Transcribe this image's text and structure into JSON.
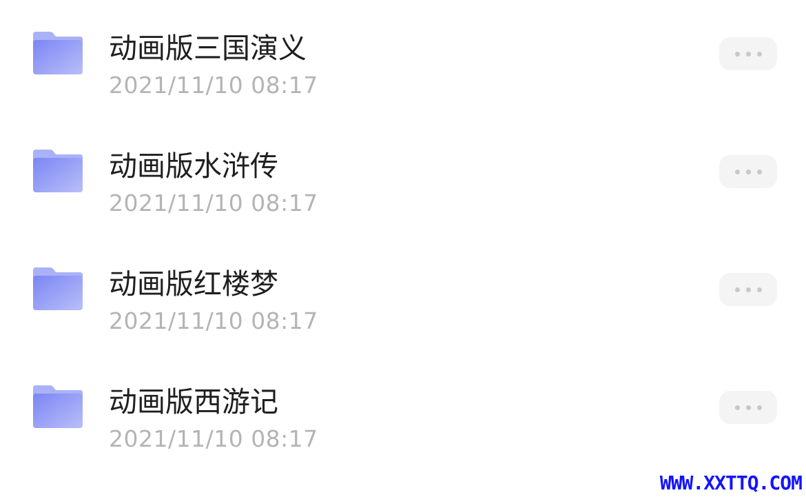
{
  "folders": [
    {
      "name": "动画版三国演义",
      "modified": "2021/11/10 08:17",
      "icon": "folder-icon"
    },
    {
      "name": "动画版水浒传",
      "modified": "2021/11/10 08:17",
      "icon": "folder-icon"
    },
    {
      "name": "动画版红楼梦",
      "modified": "2021/11/10 08:17",
      "icon": "folder-icon"
    },
    {
      "name": "动画版西游记",
      "modified": "2021/11/10 08:17",
      "icon": "folder-icon"
    }
  ],
  "more_icon": "more-horizontal-icon",
  "colors": {
    "folder_light": "#a9b2f7",
    "folder_dark": "#7b86f4",
    "title": "#1f1f1f",
    "date": "#b4b4b4",
    "more_bg": "#f4f4f4",
    "watermark": "#1414ff"
  },
  "watermark": "WWW.XXTTQ.COM"
}
